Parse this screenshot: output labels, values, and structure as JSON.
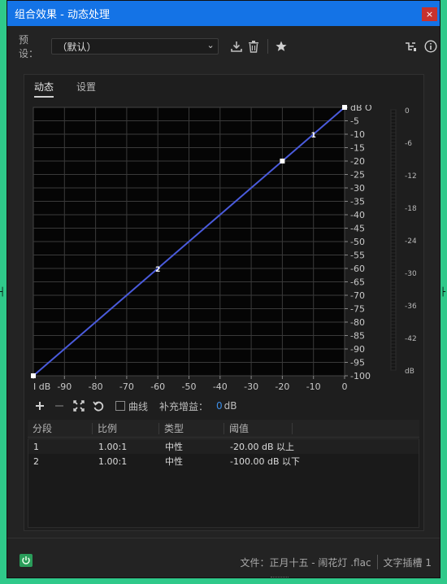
{
  "window": {
    "title": "组合效果 - 动态处理",
    "close_glyph": "×"
  },
  "toolbar": {
    "preset_label": "预设：",
    "preset_value": "（默认）",
    "icons": [
      "save-preset-icon",
      "delete-preset-icon",
      "favorite-star-icon",
      "routing-icon",
      "info-icon"
    ]
  },
  "tabs": [
    {
      "label": "动态",
      "active": true
    },
    {
      "label": "设置",
      "active": false
    }
  ],
  "graph": {
    "x_ticks": [
      "I dB",
      "-90",
      "-80",
      "-70",
      "-60",
      "-50",
      "-40",
      "-30",
      "-20",
      "-10",
      "0"
    ],
    "y_ticks": [
      "dB O",
      "-5",
      "-10",
      "-15",
      "-20",
      "-25",
      "-30",
      "-35",
      "-40",
      "-45",
      "-50",
      "-55",
      "-60",
      "-65",
      "-70",
      "-75",
      "-80",
      "-85",
      "-90",
      "-95",
      "-100"
    ],
    "meter_ticks": [
      "0",
      "-6",
      "-12",
      "-18",
      "-24",
      "-30",
      "-36",
      "-42",
      "dB"
    ],
    "curve_color": "#4a5bdc",
    "curve_points": [
      {
        "in": -100,
        "out": -100
      },
      {
        "in": -20,
        "out": -20
      },
      {
        "in": 0,
        "out": 0
      }
    ],
    "segment_labels": [
      {
        "text": "1",
        "in": -10,
        "out": -10
      },
      {
        "text": "2",
        "in": -60,
        "out": -60
      }
    ]
  },
  "controls": {
    "curve_label": "曲线",
    "curve_checked": false,
    "gain_label": "补充增益：",
    "gain_value": "0",
    "gain_unit": "dB"
  },
  "table": {
    "headers": [
      "分段",
      "比例",
      "类型",
      "阈值"
    ],
    "rows": [
      {
        "seg": "1",
        "ratio": "1.00:1",
        "type": "中性",
        "threshold": "-20.00 dB 以上"
      },
      {
        "seg": "2",
        "ratio": "1.00:1",
        "type": "中性",
        "threshold": "-100.00 dB 以下"
      }
    ]
  },
  "footer": {
    "file_label": "文件：正月十五 - 闹花灯 .flac",
    "slot_label": "文字插槽 1"
  },
  "colors": {
    "accent": "#1473e6",
    "power": "#2a9d5a",
    "close": "#c8322d",
    "gain_value": "#3d8ee6",
    "frame_bg": "#2fc98a"
  }
}
